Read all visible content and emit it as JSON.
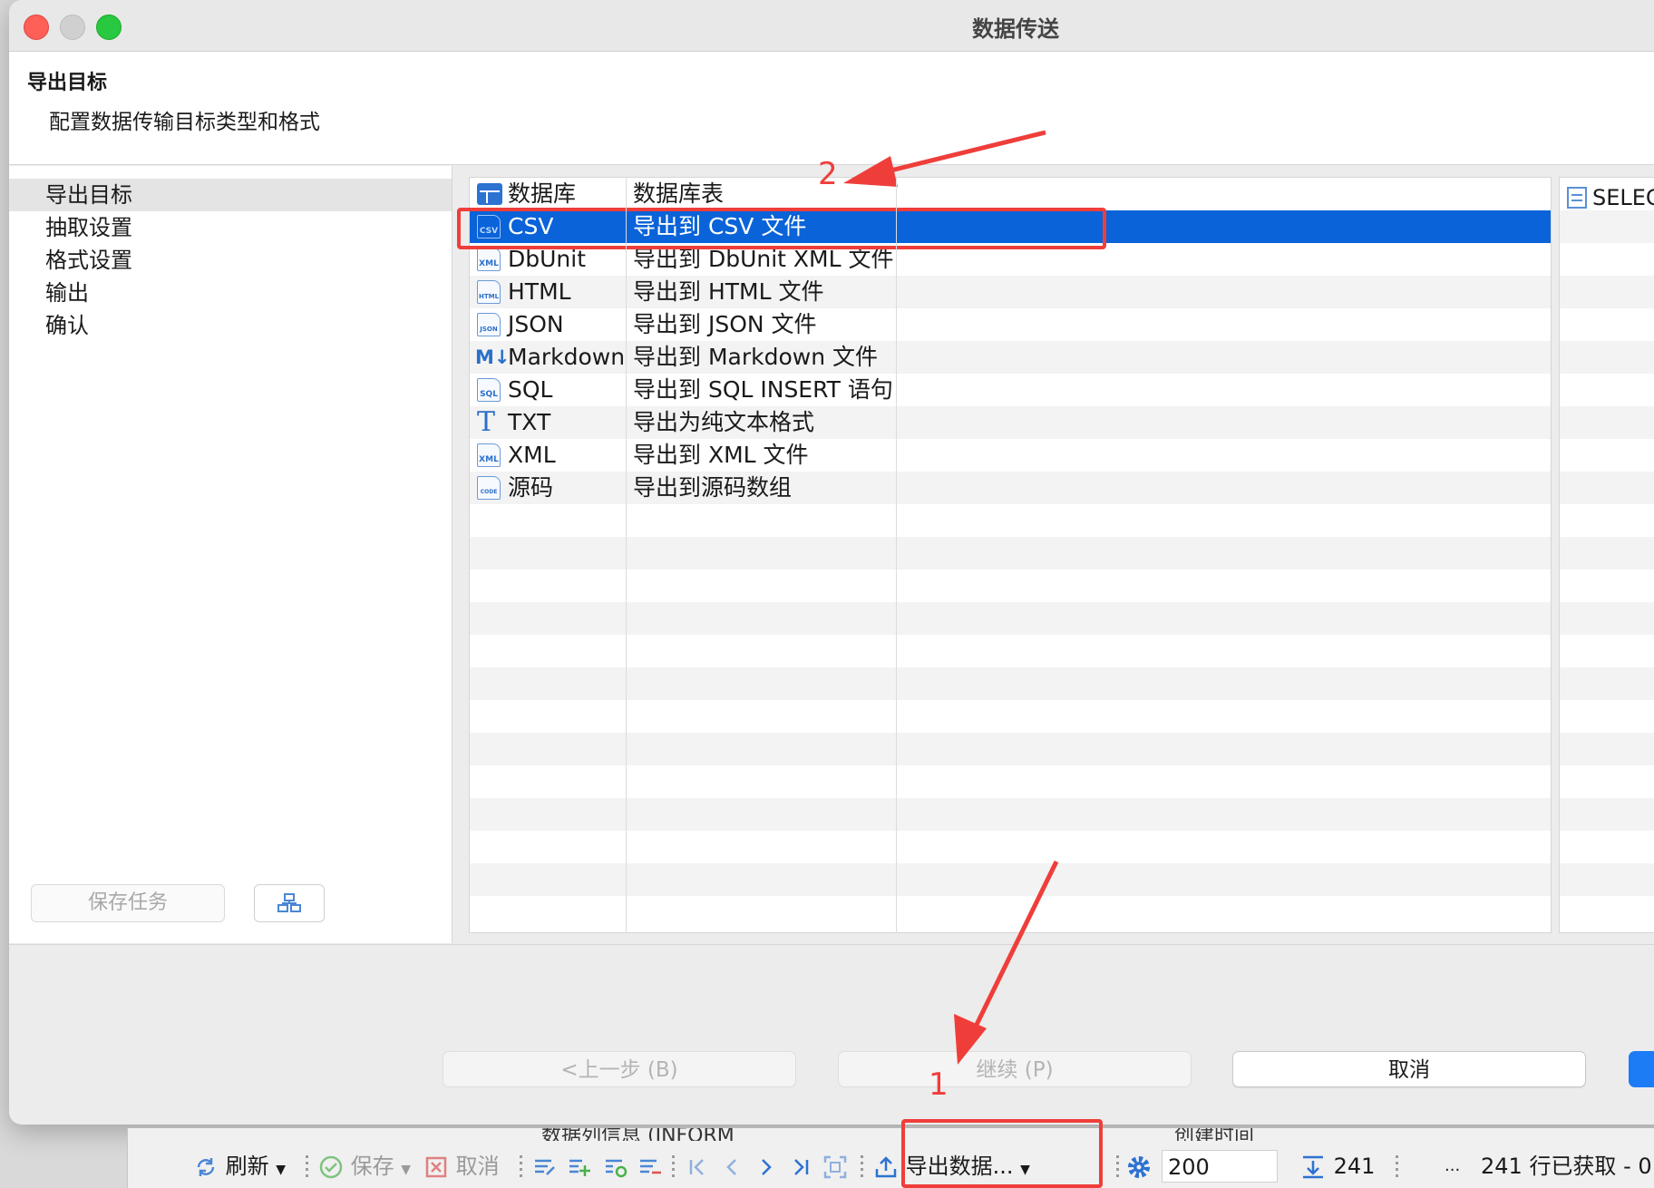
{
  "window": {
    "title": "数据传送"
  },
  "header": {
    "title": "导出目标",
    "description": "配置数据传输目标类型和格式"
  },
  "sidebar": {
    "items": [
      {
        "label": "导出目标",
        "active": true
      },
      {
        "label": "抽取设置",
        "active": false
      },
      {
        "label": "格式设置",
        "active": false
      },
      {
        "label": "输出",
        "active": false
      },
      {
        "label": "确认",
        "active": false
      }
    ],
    "save_task_label": "保存任务"
  },
  "formats": {
    "rows": [
      {
        "name": "数据库",
        "desc": "数据库表",
        "icon": "database-table-icon"
      },
      {
        "name": "CSV",
        "desc": "导出到 CSV 文件",
        "icon": "csv-file-icon",
        "icon_text": "CSV",
        "selected": true
      },
      {
        "name": "DbUnit",
        "desc": "导出到 DbUnit XML 文件",
        "icon": "xml-file-icon",
        "icon_text": "XML"
      },
      {
        "name": "HTML",
        "desc": "导出到 HTML 文件",
        "icon": "html-file-icon",
        "icon_text": "HTML"
      },
      {
        "name": "JSON",
        "desc": "导出到 JSON 文件",
        "icon": "json-file-icon",
        "icon_text": "JSON"
      },
      {
        "name": "Markdown",
        "desc": "导出到 Markdown 文件",
        "icon": "markdown-icon",
        "icon_text": "M↓"
      },
      {
        "name": "SQL",
        "desc": "导出到 SQL INSERT 语句",
        "icon": "sql-file-icon",
        "icon_text": "SQL"
      },
      {
        "name": "TXT",
        "desc": "导出为纯文本格式",
        "icon": "text-icon",
        "icon_text": "T"
      },
      {
        "name": "XML",
        "desc": "导出到 XML 文件",
        "icon": "xml-file-icon",
        "icon_text": "XML"
      },
      {
        "name": "源码",
        "desc": "导出到源码数组",
        "icon": "code-file-icon",
        "icon_text": "CODE"
      }
    ]
  },
  "right_panel": {
    "text": "SELEC"
  },
  "buttons": {
    "back": "<上一步 (B)",
    "next": "继续 (P)",
    "cancel": "取消"
  },
  "statusbar": {
    "col_headers": [
      "数据列信息 (INFORM",
      "创建时间"
    ],
    "refresh": "刷新",
    "save": "保存",
    "cancel": "取消",
    "export": "导出数据...",
    "fetch_size": "200",
    "row_count": "241",
    "ellipsis": "...",
    "fetched": "241 行已获取 - 0"
  },
  "annotations": {
    "one": "1",
    "two": "2",
    "color": "#ef3e3a"
  },
  "colors": {
    "selection": "#0a63d8",
    "accent": "#1b7cf5"
  }
}
